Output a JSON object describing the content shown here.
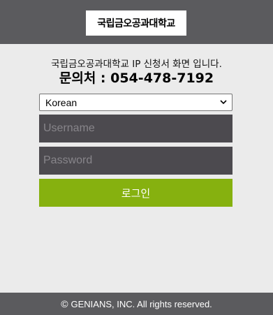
{
  "header": {
    "logo_text": "국립금오공과대학교"
  },
  "info": {
    "line1": "국립금오공과대학교 IP 신청서 화면 입니다.",
    "contact": "문의처 : 054-478-7192"
  },
  "form": {
    "language_selected": "Korean",
    "username_placeholder": "Username",
    "password_placeholder": "Password",
    "login_label": "로그인"
  },
  "footer": {
    "copyright_symbol": "©",
    "copyright_text": "GENIANS, INC. All rights reserved."
  },
  "colors": {
    "header_bg": "#5b5b5e",
    "page_bg": "#ebebeb",
    "field_bg": "#4c4a4f",
    "accent_green": "#86b10f"
  }
}
